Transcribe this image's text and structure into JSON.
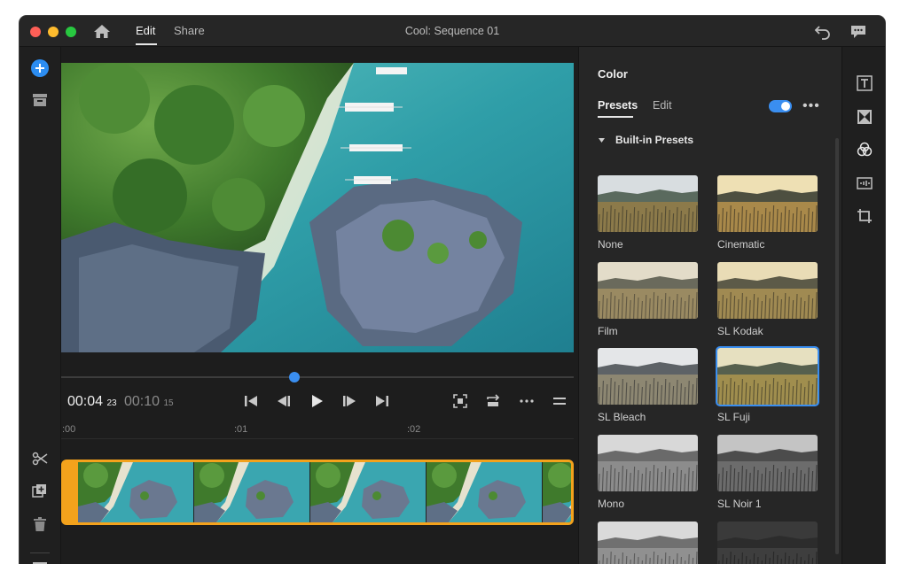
{
  "app": {
    "sequence_title": "Cool: Sequence 01",
    "tabs": [
      {
        "label": "Edit",
        "active": true
      },
      {
        "label": "Share",
        "active": false
      }
    ]
  },
  "icons": {
    "home": "home-icon",
    "undo": "undo-icon",
    "feedback": "chat-icon",
    "add": "plus-icon",
    "media": "archive-icon",
    "split": "scissors-icon",
    "duplicate": "duplicate-icon",
    "delete": "trash-icon",
    "list": "list-icon"
  },
  "player": {
    "current_time": "00:04",
    "current_frames": "23",
    "total_time": "00:10",
    "total_frames": "15",
    "controls": [
      "go-to-start",
      "step-back",
      "play",
      "step-forward",
      "go-to-end"
    ],
    "right_controls": [
      "fit-frame",
      "loop",
      "more",
      "menu"
    ]
  },
  "ruler": {
    "labels": [
      ":00",
      ":01",
      ":02"
    ]
  },
  "color_panel": {
    "title": "Color",
    "tabs": [
      {
        "label": "Presets",
        "active": true
      },
      {
        "label": "Edit",
        "active": false
      }
    ],
    "toggle_on": true,
    "more": "•••",
    "section_title": "Built-in Presets",
    "presets": [
      {
        "label": "None",
        "tone": "natural"
      },
      {
        "label": "Cinematic",
        "tone": "warm"
      },
      {
        "label": "Film",
        "tone": "faded"
      },
      {
        "label": "SL Kodak",
        "tone": "kodak"
      },
      {
        "label": "SL Bleach",
        "tone": "bleach"
      },
      {
        "label": "SL Fuji",
        "tone": "fuji",
        "selected": true
      },
      {
        "label": "Mono",
        "tone": "mono"
      },
      {
        "label": "SL Noir 1",
        "tone": "noir"
      },
      {
        "label": "",
        "tone": "mono2"
      },
      {
        "label": "",
        "tone": "dark"
      }
    ]
  },
  "colors": {
    "accent": "#3a8ef0",
    "clip_border": "#f3a21c",
    "background": "#1d1d1d",
    "panel": "#262626"
  },
  "right_rail": [
    "title-icon",
    "transition-icon",
    "color-icon",
    "audio-icon",
    "crop-icon"
  ]
}
